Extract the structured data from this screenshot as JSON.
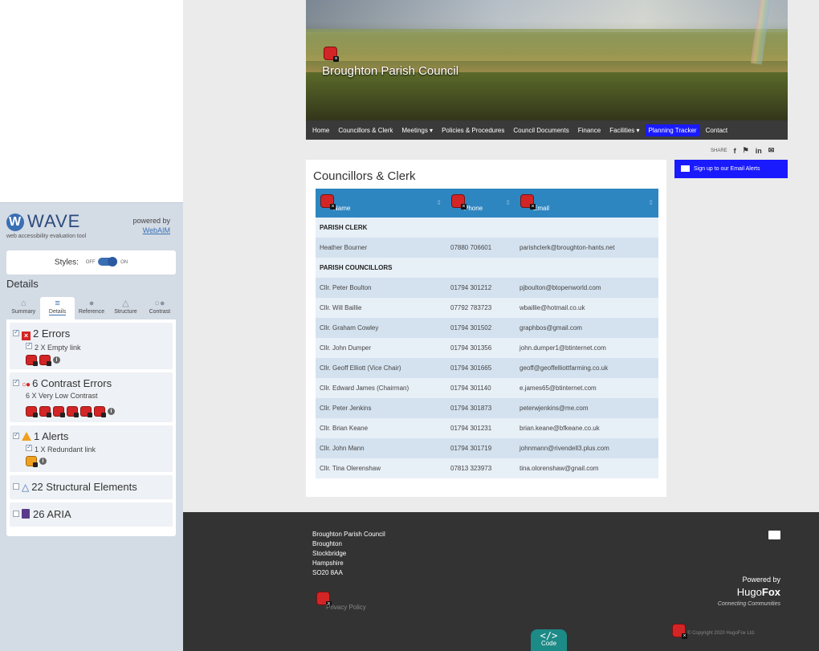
{
  "wave": {
    "logo": "WAVE",
    "logo_sub": "web accessibility evaluation tool",
    "powered_by": "powered by",
    "powered_link": "WebAIM",
    "styles_label": "Styles:",
    "styles_off": "OFF",
    "styles_on": "ON",
    "details_title": "Details",
    "tabs": [
      {
        "label": "Summary",
        "icon": "home-icon"
      },
      {
        "label": "Details",
        "icon": "list-icon"
      },
      {
        "label": "Reference",
        "icon": "info-icon"
      },
      {
        "label": "Structure",
        "icon": "structure-icon"
      },
      {
        "label": "Contrast",
        "icon": "contrast-icon"
      }
    ],
    "errors": {
      "title": "2 Errors",
      "item": "2 X Empty link"
    },
    "contrast": {
      "title": "6 Contrast Errors",
      "item": "6 X Very Low Contrast"
    },
    "alerts": {
      "title": "1 Alerts",
      "item": "1 X Redundant link"
    },
    "structural": {
      "title": "22 Structural Elements"
    },
    "aria": {
      "title": "26 ARIA"
    }
  },
  "site": {
    "title": "Broughton Parish Council",
    "nav": [
      "Home",
      "Councillors & Clerk",
      "Meetings ▾",
      "Policies & Procedures",
      "Council Documents",
      "Finance",
      "Facilities ▾",
      "Planning Tracker",
      "Contact"
    ],
    "share_label": "SHARE",
    "share_icons": [
      "f",
      "⚑",
      "in",
      "✉"
    ],
    "signup": "Sign up to our Email Alerts",
    "panel_title": "Councillors & Clerk",
    "table": {
      "headers": [
        "Name",
        "Phone",
        "Email"
      ],
      "sections": [
        {
          "label": "PARISH CLERK",
          "rows": [
            [
              "Heather Bourner",
              "07880 706601",
              "parishclerk@broughton-hants.net"
            ]
          ]
        },
        {
          "label": "PARISH COUNCILLORS",
          "rows": [
            [
              "Cllr. Peter Boulton",
              "01794 301212",
              "pjboulton@btopenworld.com"
            ],
            [
              "Cllr. Will Baillie",
              "07792 783723",
              "wbaillie@hotmail.co.uk"
            ],
            [
              "Cllr. Graham Cowley",
              "01794 301502",
              "graphbos@gmail.com"
            ],
            [
              "Cllr. John Dumper",
              "01794 301356",
              "john.dumper1@btinternet.com"
            ],
            [
              "Cllr. Geoff Elliott (Vice Chair)",
              "01794 301665",
              "geoff@geoffelliottfarming.co.uk"
            ],
            [
              "Cllr. Edward James (Chairman)",
              "01794 301140",
              "e.james65@btinternet.com"
            ],
            [
              "Cllr. Peter Jenkins",
              "01794 301873",
              "peterwjenkins@me.com"
            ],
            [
              "Cllr. Brian Keane",
              "01794 301231",
              "brian.keane@bfkeane.co.uk"
            ],
            [
              "Cllr. John Mann",
              "01794 301719",
              "johnmann@rivendell3.plus.com"
            ],
            [
              "Cllr. Tina Olerenshaw",
              "07813 323973",
              "tina.olorenshaw@gnail.com"
            ]
          ]
        }
      ]
    },
    "footer": {
      "address": [
        "Broughton Parish Council",
        "Broughton",
        "Stockbridge",
        "Hampshire",
        "SO20 8AA"
      ],
      "privacy": "Privacy Policy",
      "powered_by": "Powered by",
      "brand_light": "Hugo",
      "brand_bold": "Fox",
      "tagline": "Connecting Communities",
      "copyright": "© Copyright 2020 HugoFox Ltd.",
      "code_label": "Code",
      "code_glyph": "</>"
    }
  }
}
